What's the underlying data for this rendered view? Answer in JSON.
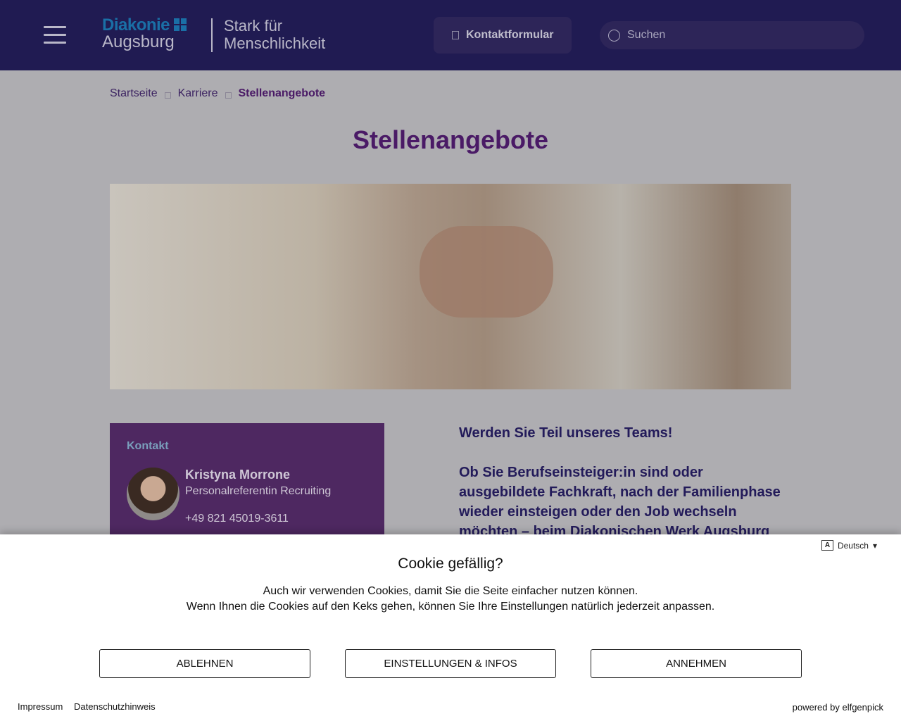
{
  "header": {
    "logo_brand": "Diakonie",
    "logo_city": "Augsburg",
    "tagline_1": "Stark für",
    "tagline_2": "Menschlichkeit",
    "contact_button": "Kontaktformular",
    "search_placeholder": "Suchen"
  },
  "breadcrumb": [
    "Startseite",
    "Karriere",
    "Stellenangebote"
  ],
  "page_title": "Stellenangebote",
  "contact": {
    "heading": "Kontakt",
    "name": "Kristyna Morrone",
    "role": "Personalreferentin Recruiting",
    "phone": "+49 821 45019-3611"
  },
  "intro": {
    "headline": "Werden Sie Teil unseres Teams!",
    "text": "Ob Sie Berufseinsteiger:in sind oder ausgebildete Fachkraft, nach der Familienphase wieder einsteigen oder den Job wechseln möchten – beim Diakonischen Werk Augsburg"
  },
  "cookie": {
    "language": "Deutsch",
    "title": "Cookie gefällig?",
    "line1": "Auch wir verwenden Cookies, damit Sie die Seite einfacher nutzen können.",
    "line2": "Wenn Ihnen die Cookies auf den Keks gehen, können Sie Ihre Einstellungen natürlich jederzeit anpassen.",
    "decline": "ABLEHNEN",
    "settings": "EINSTELLUNGEN & INFOS",
    "accept": "ANNEHMEN",
    "impressum": "Impressum",
    "privacy": "Datenschutzhinweis",
    "powered": "powered by elfgenpick"
  }
}
